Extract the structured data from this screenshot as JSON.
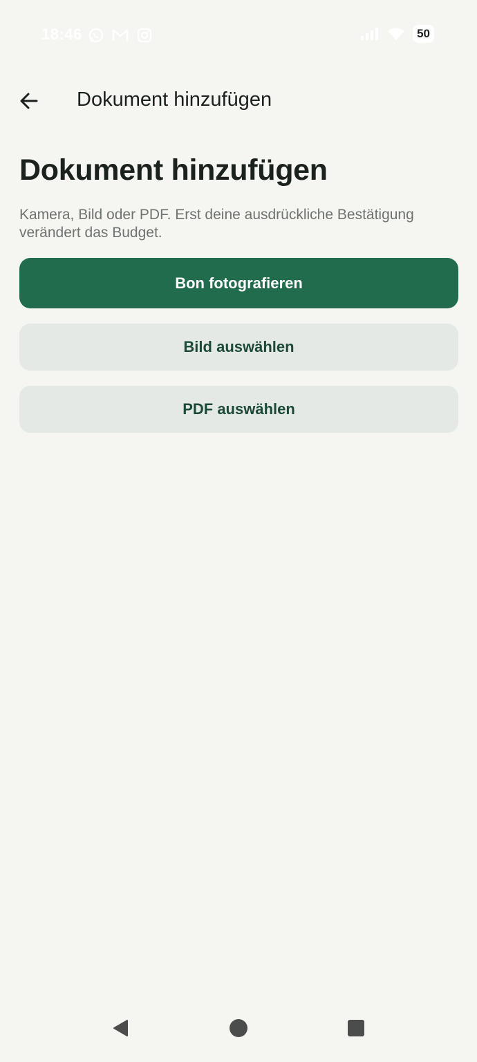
{
  "status_bar": {
    "time": "18:46",
    "battery": "50",
    "icons": [
      "whatsapp-icon",
      "gmail-icon",
      "instagram-icon",
      "signal-icon",
      "wifi-icon"
    ]
  },
  "top_bar": {
    "back_icon": "arrow-left-icon",
    "title": "Dokument hinzufügen"
  },
  "main": {
    "heading": "Dokument hinzufügen",
    "description": "Kamera, Bild oder PDF. Erst deine ausdrückliche Bestätigung verändert das Budget.",
    "buttons": {
      "camera": "Bon fotografieren",
      "image": "Bild auswählen",
      "pdf": "PDF auswählen"
    }
  },
  "colors": {
    "background": "#f5f5f1",
    "primary": "#206c4c",
    "secondary_bg": "#e4e9e5",
    "secondary_text": "#1d4a36",
    "text": "#1b211d",
    "muted_text": "#6e736f"
  },
  "nav_bar": {
    "icons": [
      "nav-back-icon",
      "nav-home-icon",
      "nav-recents-icon"
    ]
  }
}
